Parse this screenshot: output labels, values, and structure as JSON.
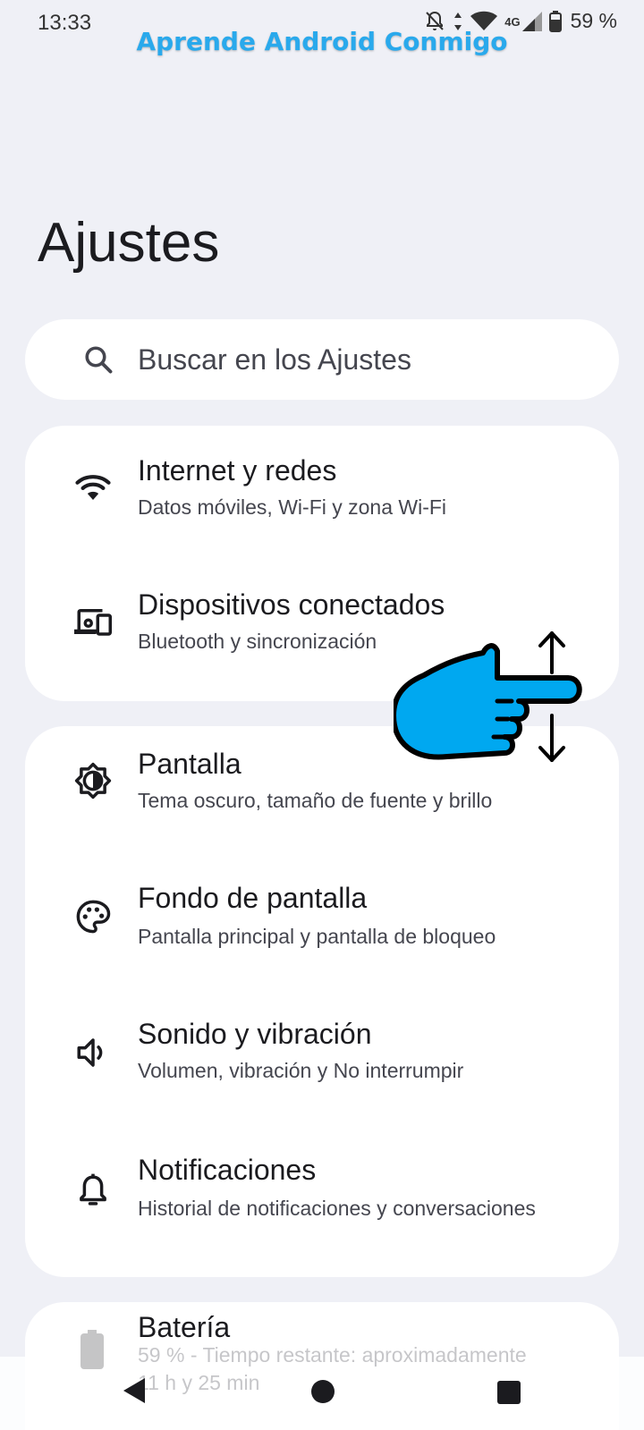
{
  "status_bar": {
    "time": "13:33",
    "network": "4G",
    "battery": "59 %"
  },
  "watermark": "Aprende Android Conmigo",
  "page": {
    "title": "Ajustes"
  },
  "search": {
    "placeholder": "Buscar en los Ajustes",
    "icon": "search-icon"
  },
  "settings_groups": [
    {
      "items": [
        {
          "title": "Internet y redes",
          "subtitle": "Datos móviles, Wi-Fi y zona Wi-Fi",
          "icon": "wifi-icon"
        },
        {
          "title": "Dispositivos conectados",
          "subtitle": "Bluetooth y sincronización",
          "icon": "devices-icon"
        }
      ]
    },
    {
      "items": [
        {
          "title": "Pantalla",
          "subtitle": "Tema oscuro, tamaño de fuente y brillo",
          "icon": "brightness-icon"
        },
        {
          "title": "Fondo de pantalla",
          "subtitle": "Pantalla principal y pantalla de bloqueo",
          "icon": "palette-icon"
        },
        {
          "title": "Sonido y vibración",
          "subtitle": "Volumen, vibración y No interrumpir",
          "icon": "volume-icon"
        },
        {
          "title": "Notificaciones",
          "subtitle": "Historial de notificaciones y conversaciones",
          "icon": "bell-icon"
        }
      ]
    },
    {
      "items": [
        {
          "title": "Batería",
          "subtitle": "59 % - Tiempo restante: aproximadamente",
          "subtitle2": "11 h y 25 min",
          "icon": "battery-icon"
        }
      ]
    }
  ],
  "gesture_overlay": {
    "icon": "swipe-hand-icon",
    "color": "#00a8f0"
  },
  "colors": {
    "background": "#eff0f6",
    "card": "#ffffff",
    "accent": "#29a9ec"
  }
}
